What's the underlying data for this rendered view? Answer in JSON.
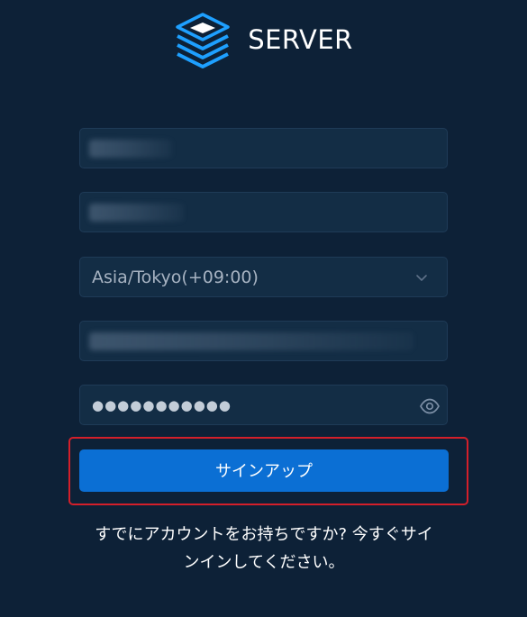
{
  "brand": {
    "name": "SERVER",
    "icon": "stacked-layers-icon",
    "color": "#1ea0ff"
  },
  "form": {
    "timezone_value": "Asia/Tokyo(+09:00)",
    "password_masked": "●●●●●●●●●●●",
    "signup_label": "サインアップ"
  },
  "footer": {
    "signin_line1": "すでにアカウントをお持ちですか? 今すぐサイ",
    "signin_line2": "ンインしてください。"
  },
  "colors": {
    "background": "#0d2137",
    "field": "#132d45",
    "button": "#0b6fd4",
    "highlight": "#d31f2a"
  }
}
